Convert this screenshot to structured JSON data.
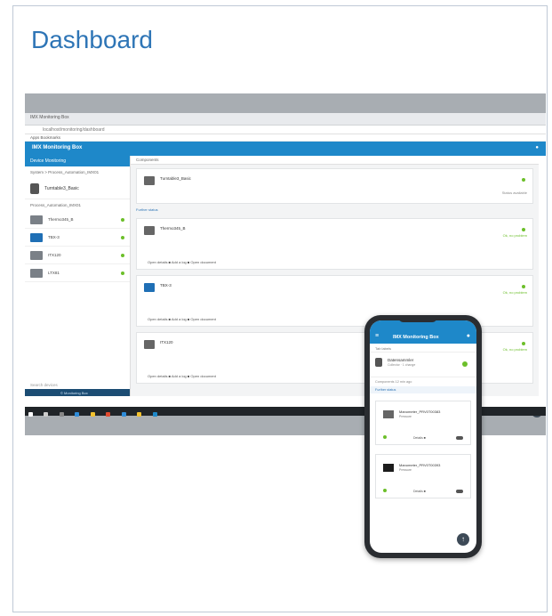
{
  "slide": {
    "title": "Dashboard"
  },
  "browser": {
    "tab_label": "IMX Monitoring Box",
    "url": "localhost/monitoring/dashboard",
    "bookmarks": "Apps  Bookmarks"
  },
  "desktop_app": {
    "app_title": "IMX Monitoring Box",
    "sidebar_header": "Device Monitoring",
    "sidebar_path": "System > Process_Automation_IMX01",
    "main_device": "Turntable3_Basic",
    "devices_header": "Process_Automation_IMX01",
    "devices": [
      {
        "name": "Thermo345_B",
        "icon": "sensor-icon"
      },
      {
        "name": "TBX-3",
        "icon": "valve-icon"
      },
      {
        "name": "ITX120",
        "icon": "motor-icon"
      },
      {
        "name": "LTX81",
        "icon": "module-icon"
      }
    ],
    "search_placeholder": "Search devices",
    "footer": "© Monitoring Box",
    "content_tab": "Components",
    "content_main_title": "Turntable3_Basic",
    "content_main_status": "Status available",
    "content_sublabel": "Further status",
    "cards": [
      {
        "title": "Thermo345_B",
        "status": "Ok, no problem",
        "actions": "Open details  ■  Add a log  ■  Open document"
      },
      {
        "title": "TBX-3",
        "status": "Ok, no problem",
        "actions": "Open details  ■  Add a log  ■  Open document"
      },
      {
        "title": "ITX120",
        "status": "Ok, no problem",
        "actions": "Open details  ■  Add a log  ■  Open document"
      }
    ]
  },
  "phone_app": {
    "app_title": "IMX Monitoring Box",
    "tab": "Tab labels",
    "main_title": "Datensammler",
    "main_sub": "Collector · 1 change",
    "info_line": "Components   12 min ago",
    "sublabel": "Further status",
    "cards": [
      {
        "title": "Manometer_PRV0T00383",
        "sub": "Pressure",
        "footer": "Details  ■"
      },
      {
        "title": "Manometer_PRV0T00393",
        "sub": "Pressure",
        "footer": "Details  ■"
      }
    ]
  },
  "colors": {
    "accent": "#1e88c9",
    "title": "#2e75b6",
    "ok": "#6cbf2a"
  }
}
